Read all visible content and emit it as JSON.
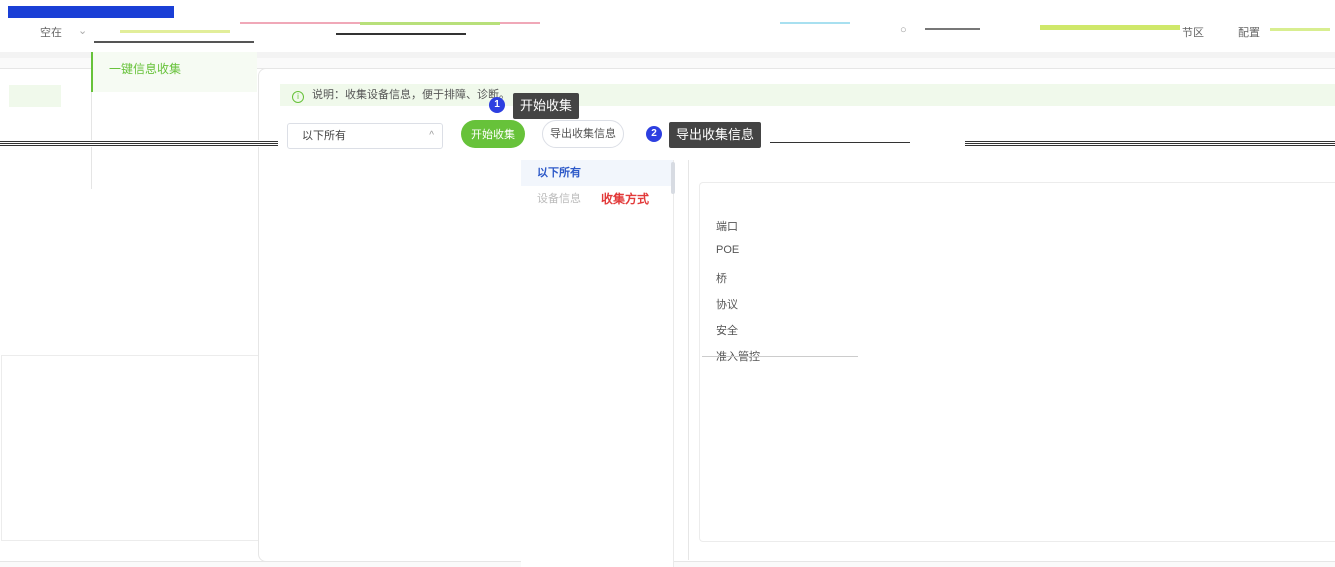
{
  "topbar": {
    "nav_left_label": "空在",
    "nav_right_label_1": "节区",
    "nav_right_label_2": "配置"
  },
  "menu": {
    "active_item": "一键信息收集"
  },
  "notice": {
    "text": "说明：收集设备信息，便于排障、诊断。"
  },
  "controls": {
    "select_value": "以下所有",
    "start_button": "开始收集",
    "export_button": "导出收集信息"
  },
  "tips": {
    "badge_1": "1",
    "tip_1": "开始收集",
    "badge_2": "2",
    "tip_2": "导出收集信息"
  },
  "dropdown": {
    "items": [
      "以下所有",
      "设备信息",
      "收集方式"
    ]
  },
  "categories": [
    "端口",
    "POE",
    "桥",
    "协议",
    "安全",
    "准入管控"
  ],
  "colors": {
    "accent_green": "#67c23a",
    "badge_blue": "#2d3fe0",
    "selected_text": "#2d59c8",
    "red_text": "#e23a3a"
  }
}
